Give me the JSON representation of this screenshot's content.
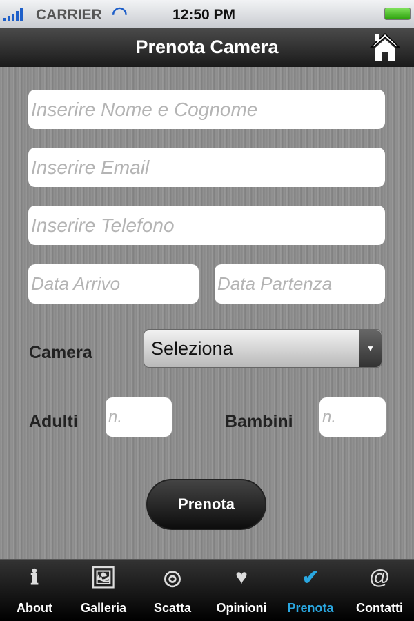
{
  "status_bar": {
    "carrier": "CARRIER",
    "time": "12:50 PM",
    "battery_level": 1.0
  },
  "nav": {
    "title": "Prenota Camera",
    "home_icon": "home-icon"
  },
  "form": {
    "name_placeholder": "Inserire Nome e Cognome",
    "email_placeholder": "Inserire Email",
    "phone_placeholder": "Inserire Telefono",
    "arrival_placeholder": "Data Arrivo",
    "departure_placeholder": "Data Partenza",
    "camera_label": "Camera",
    "camera_value": "Seleziona",
    "adults_label": "Adulti",
    "adults_placeholder": "n.",
    "children_label": "Bambini",
    "children_placeholder": "n.",
    "submit_label": "Prenota"
  },
  "tabs": [
    {
      "label": "About",
      "icon": "info-icon",
      "glyph": "ℹ"
    },
    {
      "label": "Galleria",
      "icon": "gallery-icon",
      "glyph": "🖼"
    },
    {
      "label": "Scatta",
      "icon": "camera-shutter-icon",
      "glyph": "◎"
    },
    {
      "label": "Opinioni",
      "icon": "heart-bubble-icon",
      "glyph": "♥"
    },
    {
      "label": "Prenota",
      "icon": "door-hanger-icon",
      "glyph": "✔",
      "active": true
    },
    {
      "label": "Contatti",
      "icon": "address-book-icon",
      "glyph": "@"
    }
  ],
  "colors": {
    "accent": "#2aa7e0"
  }
}
